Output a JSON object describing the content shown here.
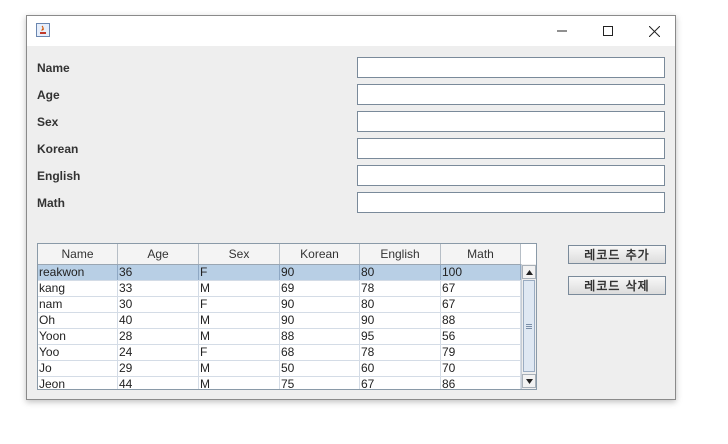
{
  "form": {
    "fields": [
      {
        "label": "Name",
        "value": ""
      },
      {
        "label": "Age",
        "value": ""
      },
      {
        "label": "Sex",
        "value": ""
      },
      {
        "label": "Korean",
        "value": ""
      },
      {
        "label": "English",
        "value": ""
      },
      {
        "label": "Math",
        "value": ""
      }
    ]
  },
  "buttons": {
    "add_record": "레코드 추가",
    "delete_record": "레코드 삭제"
  },
  "table": {
    "columns": [
      "Name",
      "Age",
      "Sex",
      "Korean",
      "English",
      "Math"
    ],
    "selected_row": 0,
    "rows": [
      [
        "reakwon",
        "36",
        "F",
        "90",
        "80",
        "100"
      ],
      [
        "kang",
        "33",
        "M",
        "69",
        "78",
        "67"
      ],
      [
        "nam",
        "30",
        "F",
        "90",
        "80",
        "67"
      ],
      [
        "Oh",
        "40",
        "M",
        "90",
        "90",
        "88"
      ],
      [
        "Yoon",
        "28",
        "M",
        "88",
        "95",
        "56"
      ],
      [
        "Yoo",
        "24",
        "F",
        "68",
        "78",
        "79"
      ],
      [
        "Jo",
        "29",
        "M",
        "50",
        "60",
        "70"
      ],
      [
        "Jeon",
        "44",
        "M",
        "75",
        "67",
        "86"
      ]
    ]
  },
  "colors": {
    "selected_row": "#b8cfe5",
    "window_bg": "#eeeeee"
  }
}
